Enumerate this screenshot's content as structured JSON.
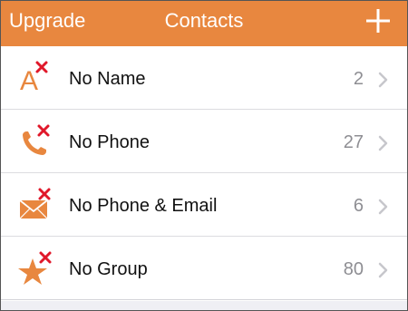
{
  "colors": {
    "accent": "#e8873f",
    "badge_x": "#e0182a",
    "count_text": "#8e8e93",
    "chevron": "#c7c7cc"
  },
  "navbar": {
    "left_label": "Upgrade",
    "title": "Contacts",
    "right_icon": "plus-icon"
  },
  "rows": [
    {
      "icon": "letter-a-icon",
      "label": "No Name",
      "count": "2"
    },
    {
      "icon": "phone-icon",
      "label": "No Phone",
      "count": "27"
    },
    {
      "icon": "envelope-icon",
      "label": "No Phone & Email",
      "count": "6"
    },
    {
      "icon": "star-icon",
      "label": "No Group",
      "count": "80"
    }
  ]
}
